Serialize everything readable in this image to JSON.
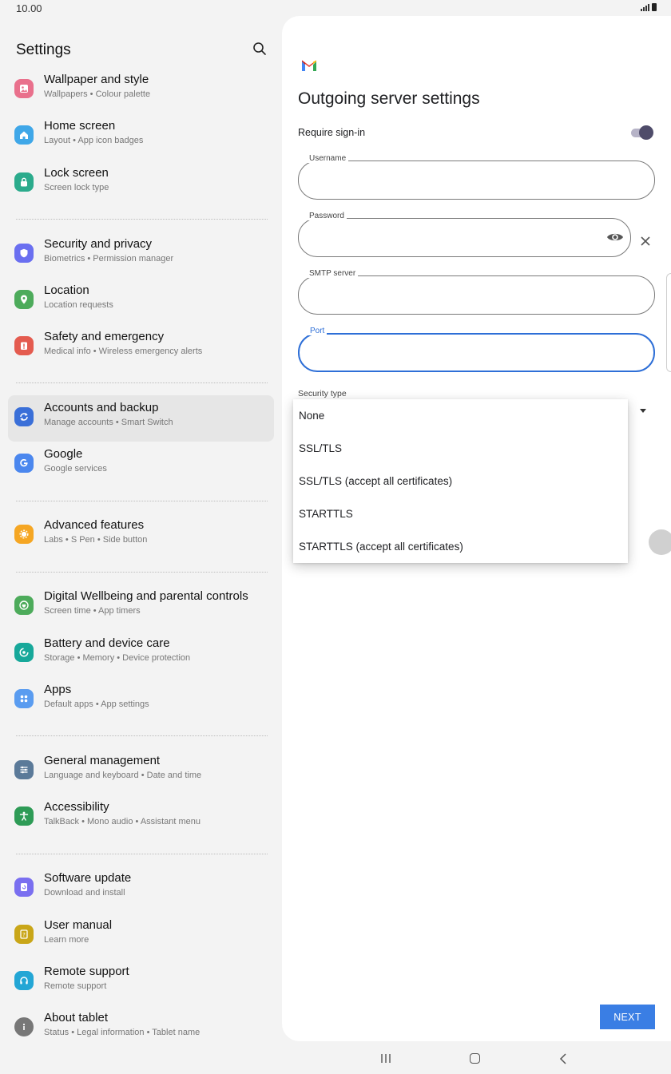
{
  "status_bar": {
    "time": "10.00"
  },
  "left_panel": {
    "title": "Settings",
    "items": [
      {
        "title": "Wallpaper and style",
        "subtitle": "Wallpapers  •  Colour palette",
        "icon": "wallpaper-icon",
        "color": "#e9708c"
      },
      {
        "title": "Home screen",
        "subtitle": "Layout  •  App icon badges",
        "icon": "home-icon",
        "color": "#3fa7e8"
      },
      {
        "title": "Lock screen",
        "subtitle": "Screen lock type",
        "icon": "lock-icon",
        "color": "#2bab8c"
      },
      {
        "title": "Security and privacy",
        "subtitle": "Biometrics  •  Permission manager",
        "icon": "shield-icon",
        "color": "#6a6ff0"
      },
      {
        "title": "Location",
        "subtitle": "Location requests",
        "icon": "location-icon",
        "color": "#4dab5b"
      },
      {
        "title": "Safety and emergency",
        "subtitle": "Medical info  •  Wireless emergency alerts",
        "icon": "emergency-icon",
        "color": "#e45b4f"
      },
      {
        "title": "Accounts and backup",
        "subtitle": "Manage accounts  •  Smart Switch",
        "icon": "sync-icon",
        "color": "#3a6fd8"
      },
      {
        "title": "Google",
        "subtitle": "Google services",
        "icon": "google-icon",
        "color": "#4b87ee"
      },
      {
        "title": "Advanced features",
        "subtitle": "Labs  •  S Pen  •  Side button",
        "icon": "advanced-features-icon",
        "color": "#f5a623"
      },
      {
        "title": "Digital Wellbeing and parental controls",
        "subtitle": "Screen time  •  App timers",
        "icon": "wellbeing-icon",
        "color": "#4dab5b"
      },
      {
        "title": "Battery and device care",
        "subtitle": "Storage  •  Memory  •  Device protection",
        "icon": "device-care-icon",
        "color": "#17a89a"
      },
      {
        "title": "Apps",
        "subtitle": "Default apps  •  App settings",
        "icon": "apps-icon",
        "color": "#5a9cf0"
      },
      {
        "title": "General management",
        "subtitle": "Language and keyboard  •  Date and time",
        "icon": "sliders-icon",
        "color": "#5b7a99"
      },
      {
        "title": "Accessibility",
        "subtitle": "TalkBack  •  Mono audio  •  Assistant menu",
        "icon": "accessibility-icon",
        "color": "#2e9b56"
      },
      {
        "title": "Software update",
        "subtitle": "Download and install",
        "icon": "software-update-icon",
        "color": "#7a6ff0"
      },
      {
        "title": "User manual",
        "subtitle": "Learn more",
        "icon": "manual-icon",
        "color": "#c9a618"
      },
      {
        "title": "Remote support",
        "subtitle": "Remote support",
        "icon": "headset-icon",
        "color": "#23a6d5"
      },
      {
        "title": "About tablet",
        "subtitle": "Status  •  Legal information  •  Tablet name",
        "icon": "info-icon",
        "color": "#777777"
      }
    ]
  },
  "right_panel": {
    "title": "Outgoing server settings",
    "require_signin": {
      "label": "Require sign-in",
      "enabled": true
    },
    "fields": {
      "username": {
        "label": "Username",
        "value": ""
      },
      "password": {
        "label": "Password",
        "value": ""
      },
      "smtp_server": {
        "label": "SMTP server",
        "value": ""
      },
      "port": {
        "label": "Port",
        "value": ""
      }
    },
    "security_type": {
      "label": "Security type",
      "options": [
        "None",
        "SSL/TLS",
        "SSL/TLS (accept all certificates)",
        "STARTTLS",
        "STARTTLS (accept all certificates)"
      ]
    },
    "next_label": "NEXT"
  }
}
